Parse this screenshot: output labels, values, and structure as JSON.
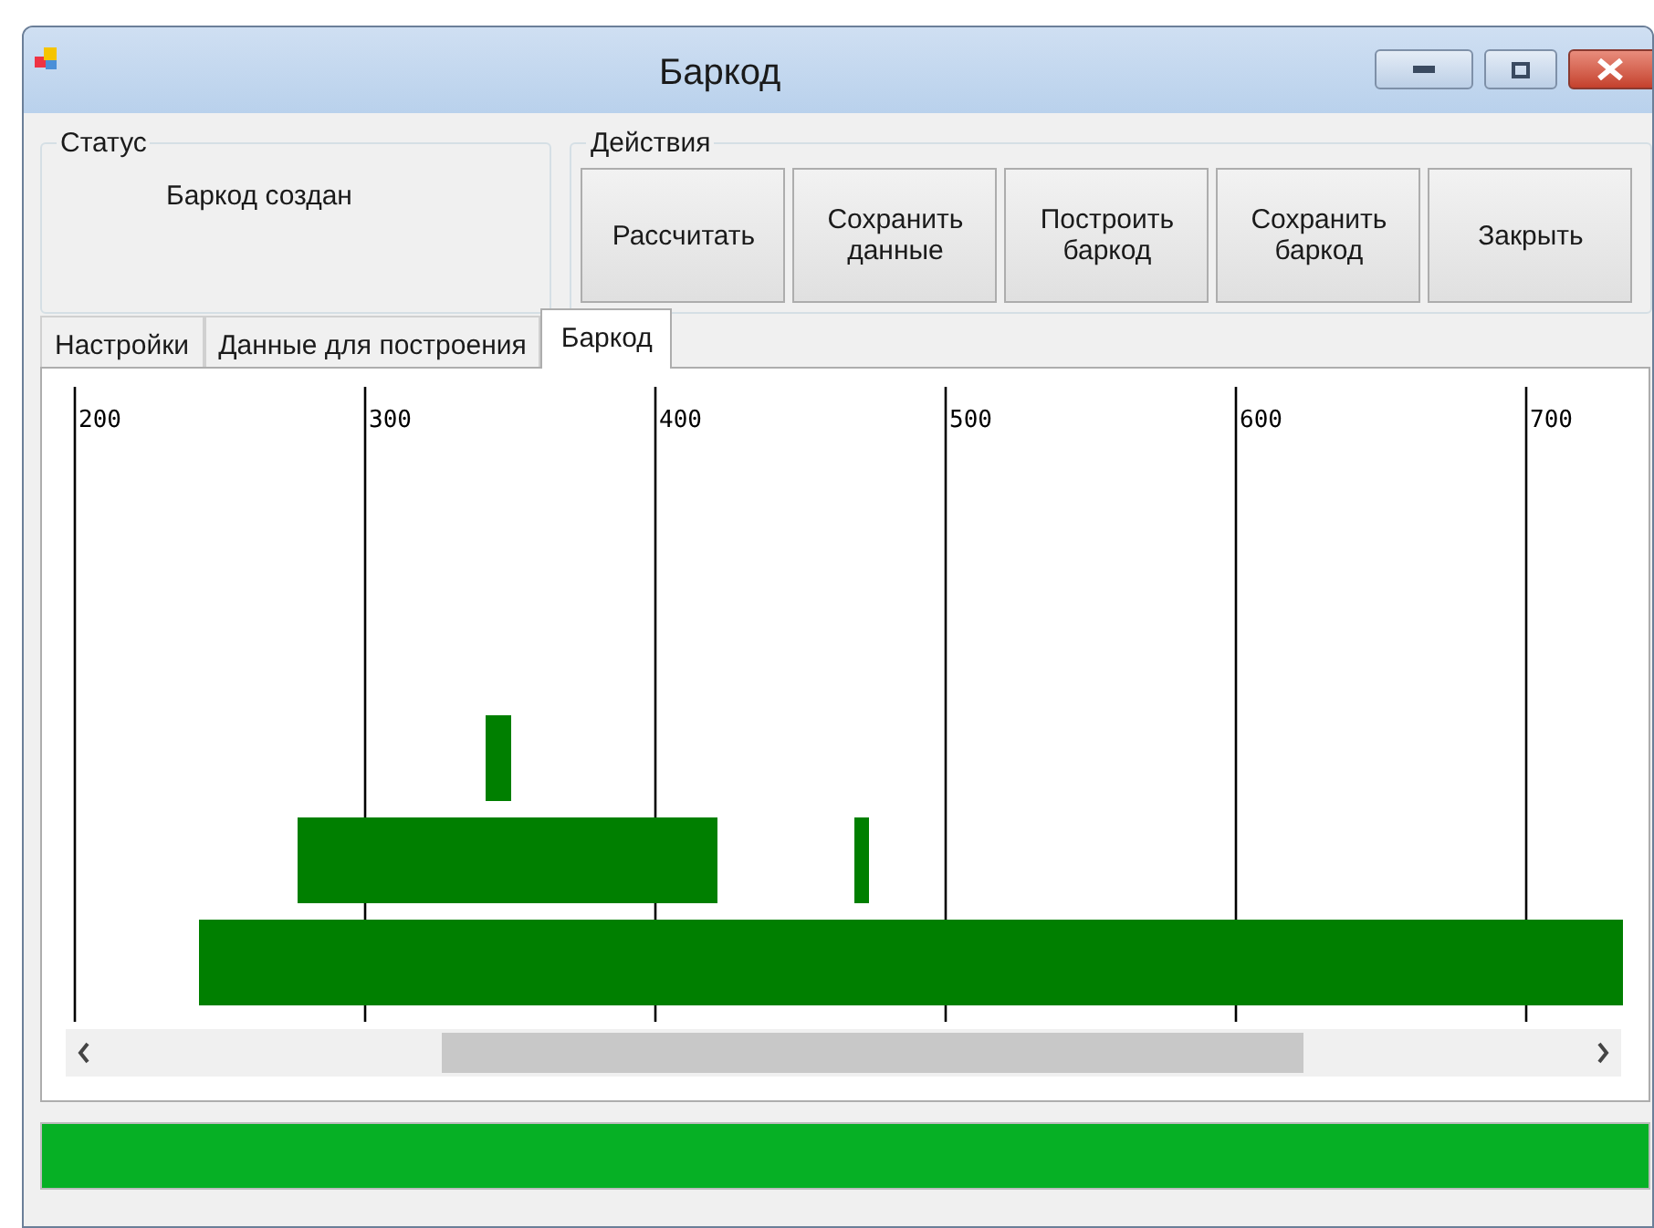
{
  "window": {
    "title": "Баркод"
  },
  "status": {
    "title": "Статус",
    "text": "Баркод создан"
  },
  "actions": {
    "title": "Действия",
    "buttons": [
      "Рассчитать",
      "Сохранить данные",
      "Построить баркод",
      "Сохранить баркод",
      "Закрыть"
    ]
  },
  "tabs": [
    {
      "label": "Настройки",
      "selected": false
    },
    {
      "label": "Данные для построения",
      "selected": false
    },
    {
      "label": "Баркод",
      "selected": true
    }
  ],
  "barcode": {
    "ticks": [
      "200",
      "300",
      "400",
      "500",
      "600",
      "700"
    ]
  },
  "progress": {
    "level": 1
  }
}
